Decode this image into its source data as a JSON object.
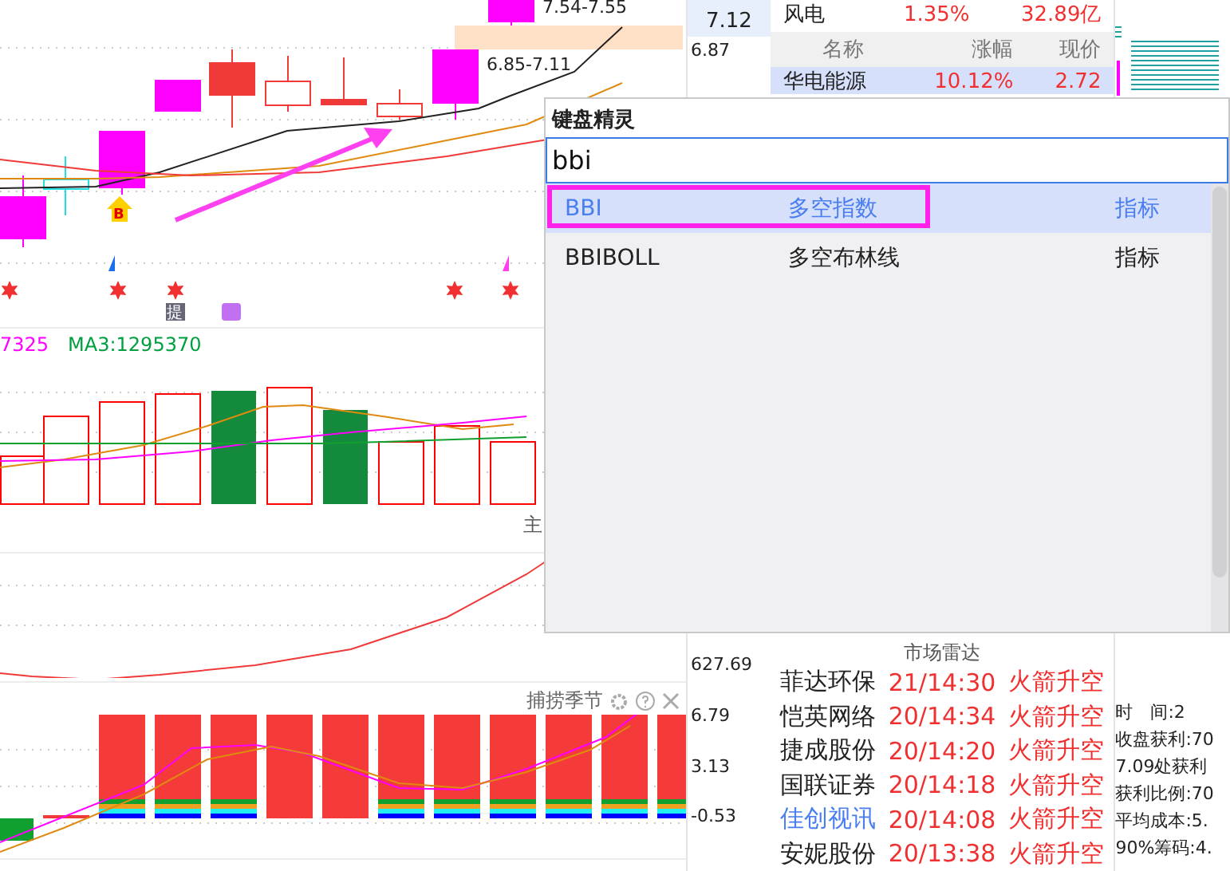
{
  "price_chart": {
    "range_labels": [
      "7.54-7.55",
      "6.85-7.11"
    ],
    "buy_marker": "B",
    "badge": "提"
  },
  "volume_chart": {
    "legend": [
      {
        "text": "7325",
        "color": "#ff00ff"
      },
      {
        "text": "MA3:1295370",
        "color": "#00a040"
      }
    ],
    "corner_label": "主"
  },
  "indicator_panel": {
    "title": "捕捞季节"
  },
  "price_axis": {
    "current": "7.12",
    "labels": [
      "6.87"
    ],
    "lower_label": "627.69",
    "indicator_ticks": [
      "6.79",
      "3.13",
      "-0.53"
    ]
  },
  "sector_row": {
    "name": "风电",
    "change": "1.35%",
    "amount": "32.89亿"
  },
  "stock_table": {
    "columns": [
      "名称",
      "涨幅",
      "现价"
    ],
    "rows": [
      {
        "name": "华电能源",
        "change": "10.12%",
        "price": "2.72",
        "selected": true
      }
    ]
  },
  "market_radar": {
    "title": "市场雷达",
    "rows": [
      {
        "name": "菲达环保",
        "time": "21/14:30",
        "signal": "火箭升空",
        "color": "#222222"
      },
      {
        "name": "恺英网络",
        "time": "20/14:34",
        "signal": "火箭升空",
        "color": "#222222"
      },
      {
        "name": "捷成股份",
        "time": "20/14:20",
        "signal": "火箭升空",
        "color": "#222222"
      },
      {
        "name": "国联证券",
        "time": "20/14:18",
        "signal": "火箭升空",
        "color": "#222222"
      },
      {
        "name": "佳创视讯",
        "time": "20/14:08",
        "signal": "火箭升空",
        "color": "#4a7ef0"
      },
      {
        "name": "安妮股份",
        "time": "20/13:38",
        "signal": "火箭升空",
        "color": "#222222"
      }
    ]
  },
  "chip_info": [
    "时　间:2",
    "收盘获利:70",
    "7.09处获利",
    "获利比例:70",
    "平均成本:5.",
    "90%筹码:4."
  ],
  "popup": {
    "title": "键盘精灵",
    "query": "bbi",
    "results": [
      {
        "code": "BBI",
        "name": "多空指数",
        "type": "指标",
        "selected": true,
        "outlined": true
      },
      {
        "code": "BBIBOLL",
        "name": "多空布林线",
        "type": "指标",
        "selected": false,
        "outlined": false
      }
    ]
  }
}
